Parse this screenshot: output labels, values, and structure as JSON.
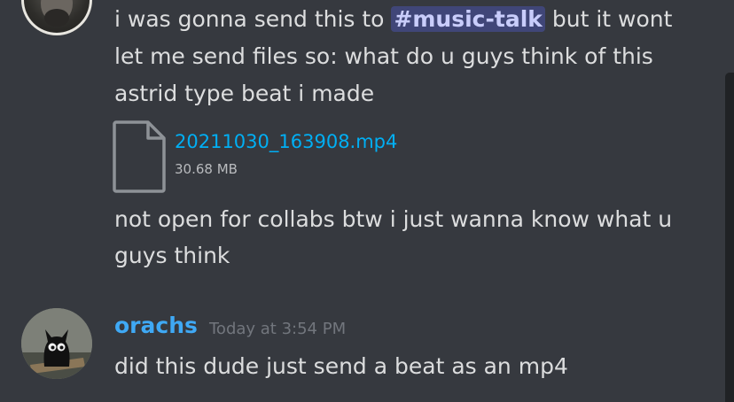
{
  "message_1": {
    "line_1_before": "i was gonna send this to ",
    "mention": "#music-talk",
    "line_1_after": "  but it wont",
    "line_2": "let me send files so: what do u guys think of this",
    "line_3": "astrid type beat i made"
  },
  "attachment": {
    "file_name": "20211030_163908.mp4",
    "file_size": "30.68 MB",
    "icon": "file-icon"
  },
  "message_2": {
    "line_1": "not open for collabs btw i just wanna know what u",
    "line_2": "guys think"
  },
  "message_3": {
    "author": "orachs",
    "timestamp": "Today at 3:54 PM",
    "text": "did this dude just send a beat as an mp4"
  },
  "colors": {
    "background": "#36393f",
    "text": "#dcddde",
    "link": "#00aff4",
    "username": "#3fa9f5",
    "timestamp": "#72767d",
    "mention_bg": "#5865f2"
  }
}
